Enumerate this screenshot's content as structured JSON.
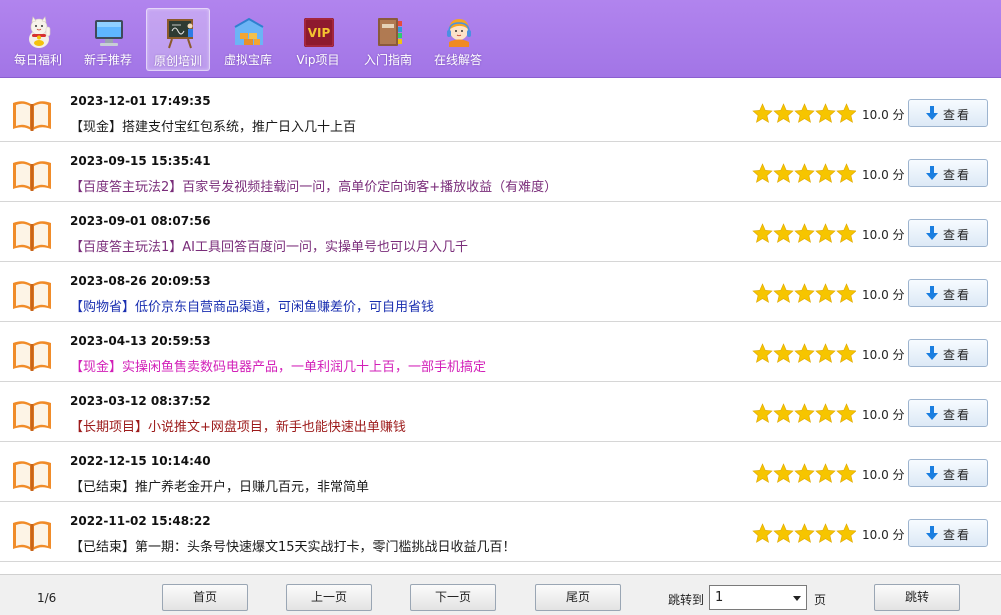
{
  "nav": [
    {
      "label": "每日福利",
      "icon": "lucky-cat-icon"
    },
    {
      "label": "新手推荐",
      "icon": "monitor-icon"
    },
    {
      "label": "原创培训",
      "icon": "chalkboard-icon"
    },
    {
      "label": "虚拟宝库",
      "icon": "warehouse-icon"
    },
    {
      "label": "Vip项目",
      "icon": "vip-icon",
      "badge": "VIP"
    },
    {
      "label": "入门指南",
      "icon": "books-icon"
    },
    {
      "label": "在线解答",
      "icon": "support-agent-icon"
    }
  ],
  "active_nav": "原创培训",
  "colors": {
    "toolbar": "#a97ceb",
    "star": "#f6c500",
    "tag_black": "#1a1a1a",
    "tag_purple": "#7a2d7a",
    "tag_blue": "#1a2fb0",
    "tag_magenta": "#d21fb8",
    "tag_red": "#9c1a1a"
  },
  "items": [
    {
      "date": "2023-12-01 17:49:35",
      "title": "【现金】搭建支付宝红包系统，推广日入几十上百",
      "color": "#1a1a1a",
      "rating": 5,
      "score": "10.0 分",
      "button": "查看"
    },
    {
      "date": "2023-09-15 15:35:41",
      "title": "【百度答主玩法2】百家号发视频挂载问一问，高单价定向询客+播放收益（有难度）",
      "color": "#7a2d7a",
      "rating": 5,
      "score": "10.0 分",
      "button": "查看"
    },
    {
      "date": "2023-09-01 08:07:56",
      "title": "【百度答主玩法1】AI工具回答百度问一问，实操单号也可以月入几千",
      "color": "#7a2d7a",
      "rating": 5,
      "score": "10.0 分",
      "button": "查看"
    },
    {
      "date": "2023-08-26 20:09:53",
      "title": "【购物省】低价京东自营商品渠道，可闲鱼赚差价，可自用省钱",
      "color": "#1a2fb0",
      "rating": 5,
      "score": "10.0 分",
      "button": "查看"
    },
    {
      "date": "2023-04-13 20:59:53",
      "title": "【现金】实操闲鱼售卖数码电器产品，一单利润几十上百，一部手机搞定",
      "color": "#d21fb8",
      "rating": 5,
      "score": "10.0 分",
      "button": "查看"
    },
    {
      "date": "2023-03-12 08:37:52",
      "title": "【长期项目】小说推文+网盘项目，新手也能快速出单赚钱",
      "color": "#9c1a1a",
      "rating": 5,
      "score": "10.0 分",
      "button": "查看"
    },
    {
      "date": "2022-12-15 10:14:40",
      "title": "【已结束】推广养老金开户，日赚几百元，非常简单",
      "color": "#1a1a1a",
      "rating": 5,
      "score": "10.0 分",
      "button": "查看"
    },
    {
      "date": "2022-11-02 15:48:22",
      "title": "【已结束】第一期：头条号快速爆文15天实战打卡，零门槛挑战日收益几百！",
      "color": "#1a1a1a",
      "rating": 5,
      "score": "10.0 分",
      "button": "查看"
    }
  ],
  "pager": {
    "page_info": "1/6",
    "first": "首页",
    "prev": "上一页",
    "next": "下一页",
    "last": "尾页",
    "jump_label": "跳转到",
    "page_value": "1",
    "page_unit": "页",
    "go": "跳转"
  }
}
